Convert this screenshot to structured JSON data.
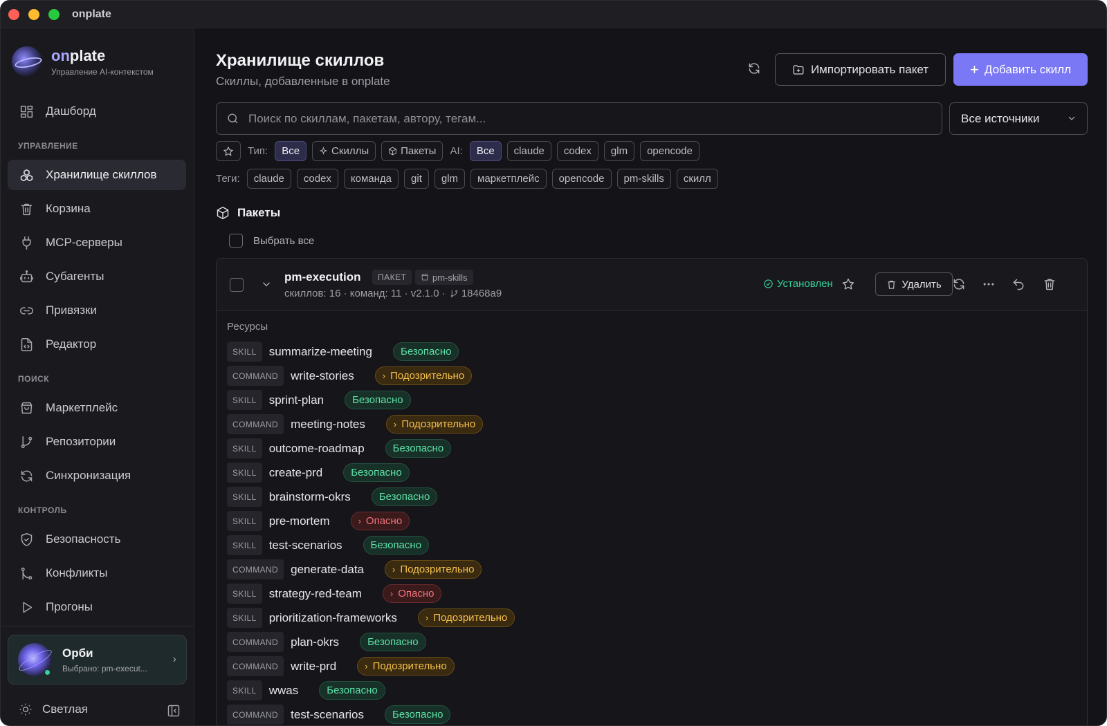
{
  "window": {
    "title": "onplate"
  },
  "brand": {
    "name_prefix": "on",
    "name_suffix": "plate",
    "subtitle": "Управление AI-контекстом"
  },
  "sidebar": {
    "top_item": {
      "label": "Дашборд",
      "icon": "dashboard-icon"
    },
    "sections": [
      {
        "title": "УПРАВЛЕНИЕ"
      },
      {
        "title": "ПОИСК"
      },
      {
        "title": "КОНТРОЛЬ"
      }
    ],
    "items": [
      {
        "label": "Хранилище скиллов",
        "icon": "skills-vault-icon",
        "active": true
      },
      {
        "label": "Корзина",
        "icon": "trash-icon"
      },
      {
        "label": "MCP-серверы",
        "icon": "plug-icon"
      },
      {
        "label": "Субагенты",
        "icon": "bot-icon"
      },
      {
        "label": "Привязки",
        "icon": "link-icon"
      },
      {
        "label": "Редактор",
        "icon": "file-code-icon"
      },
      {
        "label": "Маркетплейс",
        "icon": "store-icon"
      },
      {
        "label": "Репозитории",
        "icon": "git-branch-icon"
      },
      {
        "label": "Синхронизация",
        "icon": "sync-icon"
      },
      {
        "label": "Безопасность",
        "icon": "shield-icon"
      },
      {
        "label": "Конфликты",
        "icon": "git-merge-icon"
      },
      {
        "label": "Прогоны",
        "icon": "play-icon"
      }
    ],
    "orbi": {
      "name": "Орби",
      "subtitle": "Выбрано: pm-execut..."
    },
    "theme": {
      "label": "Светлая"
    }
  },
  "header": {
    "title": "Хранилище скиллов",
    "subtitle": "Скиллы, добавленные в onplate",
    "import_label": "Импортировать пакет",
    "add_label": "Добавить скилл"
  },
  "search": {
    "placeholder": "Поиск по скиллам, пакетам, автору, тегам...",
    "source_value": "Все источники"
  },
  "filters": {
    "type_label": "Тип:",
    "type_options": [
      "Все",
      "Скиллы",
      "Пакеты"
    ],
    "ai_label": "AI:",
    "ai_options": [
      "Все",
      "claude",
      "codex",
      "glm",
      "opencode"
    ],
    "tags_label": "Теги:",
    "tags": [
      "claude",
      "codex",
      "команда",
      "git",
      "glm",
      "маркетплейс",
      "opencode",
      "pm-skills",
      "скилл"
    ]
  },
  "packages": {
    "title": "Пакеты",
    "select_all": "Выбрать все",
    "items": [
      {
        "name": "pm-execution",
        "badge": "ПАКЕТ",
        "tag": "pm-skills",
        "meta": "скиллов: 16 · команд: 11 · v2.1.0 ·",
        "commit": "18468a9",
        "status": "Установлен",
        "delete_label": "Удалить",
        "resources_label": "Ресурсы",
        "resources": [
          {
            "kind": "SKILL",
            "name": "summarize-meeting",
            "status": "Безопасно",
            "level": "safe"
          },
          {
            "kind": "COMMAND",
            "name": "write-stories",
            "status": "Подозрительно",
            "level": "warn"
          },
          {
            "kind": "SKILL",
            "name": "sprint-plan",
            "status": "Безопасно",
            "level": "safe"
          },
          {
            "kind": "COMMAND",
            "name": "meeting-notes",
            "status": "Подозрительно",
            "level": "warn"
          },
          {
            "kind": "SKILL",
            "name": "outcome-roadmap",
            "status": "Безопасно",
            "level": "safe"
          },
          {
            "kind": "SKILL",
            "name": "create-prd",
            "status": "Безопасно",
            "level": "safe"
          },
          {
            "kind": "SKILL",
            "name": "brainstorm-okrs",
            "status": "Безопасно",
            "level": "safe"
          },
          {
            "kind": "SKILL",
            "name": "pre-mortem",
            "status": "Опасно",
            "level": "danger"
          },
          {
            "kind": "SKILL",
            "name": "test-scenarios",
            "status": "Безопасно",
            "level": "safe"
          },
          {
            "kind": "COMMAND",
            "name": "generate-data",
            "status": "Подозрительно",
            "level": "warn"
          },
          {
            "kind": "SKILL",
            "name": "strategy-red-team",
            "status": "Опасно",
            "level": "danger"
          },
          {
            "kind": "SKILL",
            "name": "prioritization-frameworks",
            "status": "Подозрительно",
            "level": "warn"
          },
          {
            "kind": "COMMAND",
            "name": "plan-okrs",
            "status": "Безопасно",
            "level": "safe"
          },
          {
            "kind": "COMMAND",
            "name": "write-prd",
            "status": "Подозрительно",
            "level": "warn"
          },
          {
            "kind": "SKILL",
            "name": "wwas",
            "status": "Безопасно",
            "level": "safe"
          },
          {
            "kind": "COMMAND",
            "name": "test-scenarios",
            "status": "Безопасно",
            "level": "safe"
          }
        ]
      }
    ]
  },
  "colors": {
    "accent": "#7b78f5",
    "safe": "#5ee0a7",
    "warn": "#f5c04a",
    "danger": "#f2747c",
    "installed": "#34d399"
  }
}
